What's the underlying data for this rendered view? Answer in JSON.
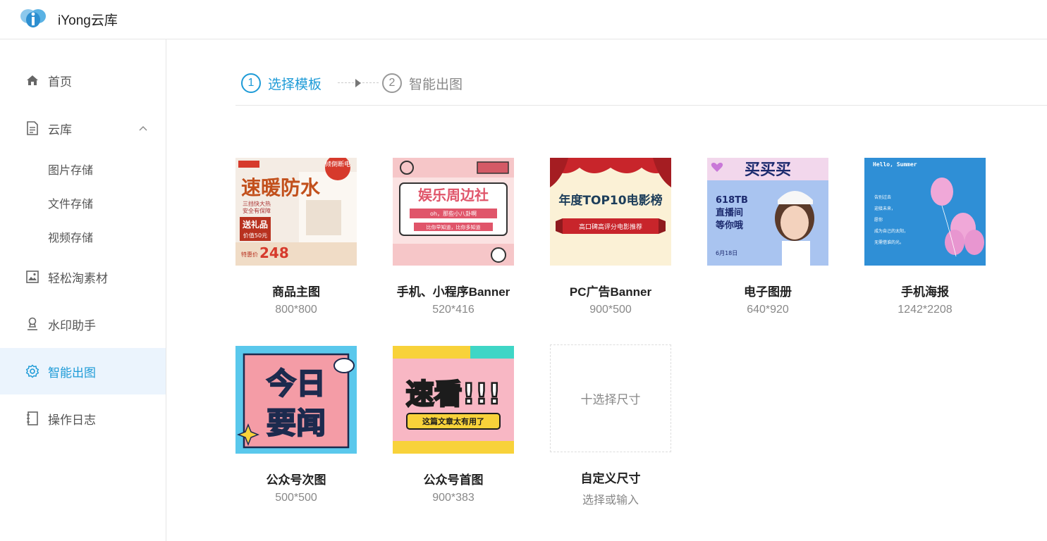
{
  "header": {
    "app_title": "iYong云库"
  },
  "sidebar": {
    "items": [
      {
        "label": "首页",
        "icon": "home-icon"
      },
      {
        "label": "云库",
        "icon": "document-icon"
      },
      {
        "label": "轻松淘素材",
        "icon": "image-icon"
      },
      {
        "label": "水印助手",
        "icon": "stamp-icon"
      },
      {
        "label": "智能出图",
        "icon": "gear-icon"
      },
      {
        "label": "操作日志",
        "icon": "notebook-icon"
      }
    ],
    "sub_items": [
      {
        "label": "图片存储"
      },
      {
        "label": "文件存储"
      },
      {
        "label": "视频存储"
      }
    ]
  },
  "steps": [
    {
      "num": "1",
      "label": "选择模板"
    },
    {
      "num": "2",
      "label": "智能出图"
    }
  ],
  "templates": [
    {
      "title": "商品主图",
      "size": "800*800",
      "thumb": {
        "badge": "倾倒断电",
        "headline": "速暖防水",
        "bullets": [
          "三挡快大热",
          "安全有保障"
        ],
        "gift": "送礼品",
        "gift_value": "价值50元",
        "price_label": "特惠价",
        "price": "248"
      }
    },
    {
      "title": "手机、小程序Banner",
      "size": "520*416",
      "thumb": {
        "headline": "娱乐周边社",
        "line1": "oh，那些小八卦啊",
        "line2": "比你早知道，比你多知道"
      }
    },
    {
      "title": "PC广告Banner",
      "size": "900*500",
      "thumb": {
        "headline": "年度TOP10电影榜",
        "ribbon": "高口碑高评分电影推荐"
      }
    },
    {
      "title": "电子图册",
      "size": "640*920",
      "thumb": {
        "top": "买买买",
        "line1": "618TB",
        "line2": "直播间",
        "line3": "等你哦",
        "date": "6月18日"
      }
    },
    {
      "title": "手机海报",
      "size": "1242*2208",
      "thumb": {
        "tag": "Hello, Summer",
        "lines": [
          "告别过去",
          "迎接未来，",
          "愿你",
          "成为自己的太阳，",
          "无需借谁的光。"
        ]
      }
    },
    {
      "title": "公众号次图",
      "size": "500*500",
      "thumb": {
        "line1": "今日",
        "line2": "要闻"
      }
    },
    {
      "title": "公众号首图",
      "size": "900*383",
      "thumb": {
        "headline": "速看!!!",
        "sub": "这篇文章太有用了"
      }
    }
  ],
  "custom": {
    "button": "十选择尺寸",
    "title": "自定义尺寸",
    "hint": "选择或输入"
  },
  "colors": {
    "accent": "#1e9bd7",
    "active_bg": "#ebf4fd"
  }
}
